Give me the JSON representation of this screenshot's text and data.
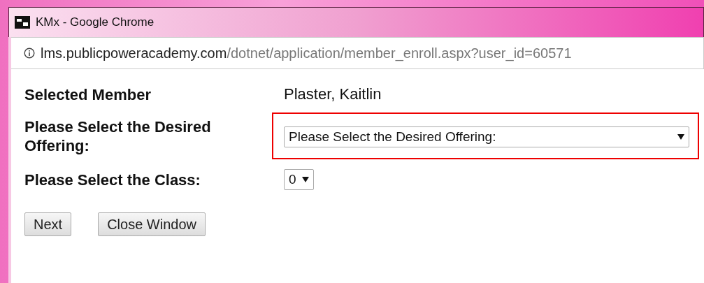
{
  "window": {
    "title": "KMx - Google Chrome"
  },
  "address_bar": {
    "host": "lms.publicpoweracademy.com",
    "path": "/dotnet/application/member_enroll.aspx?user_id=60571"
  },
  "form": {
    "selected_member": {
      "label": "Selected Member",
      "value": "Plaster, Kaitlin"
    },
    "offering": {
      "label": "Please Select the Desired Offering:",
      "value": "Please Select the Desired Offering:",
      "highlighted": true
    },
    "class": {
      "label": "Please Select the Class:",
      "value": "0",
      "highlighted": false
    }
  },
  "buttons": [
    "Next",
    "Close Window"
  ]
}
